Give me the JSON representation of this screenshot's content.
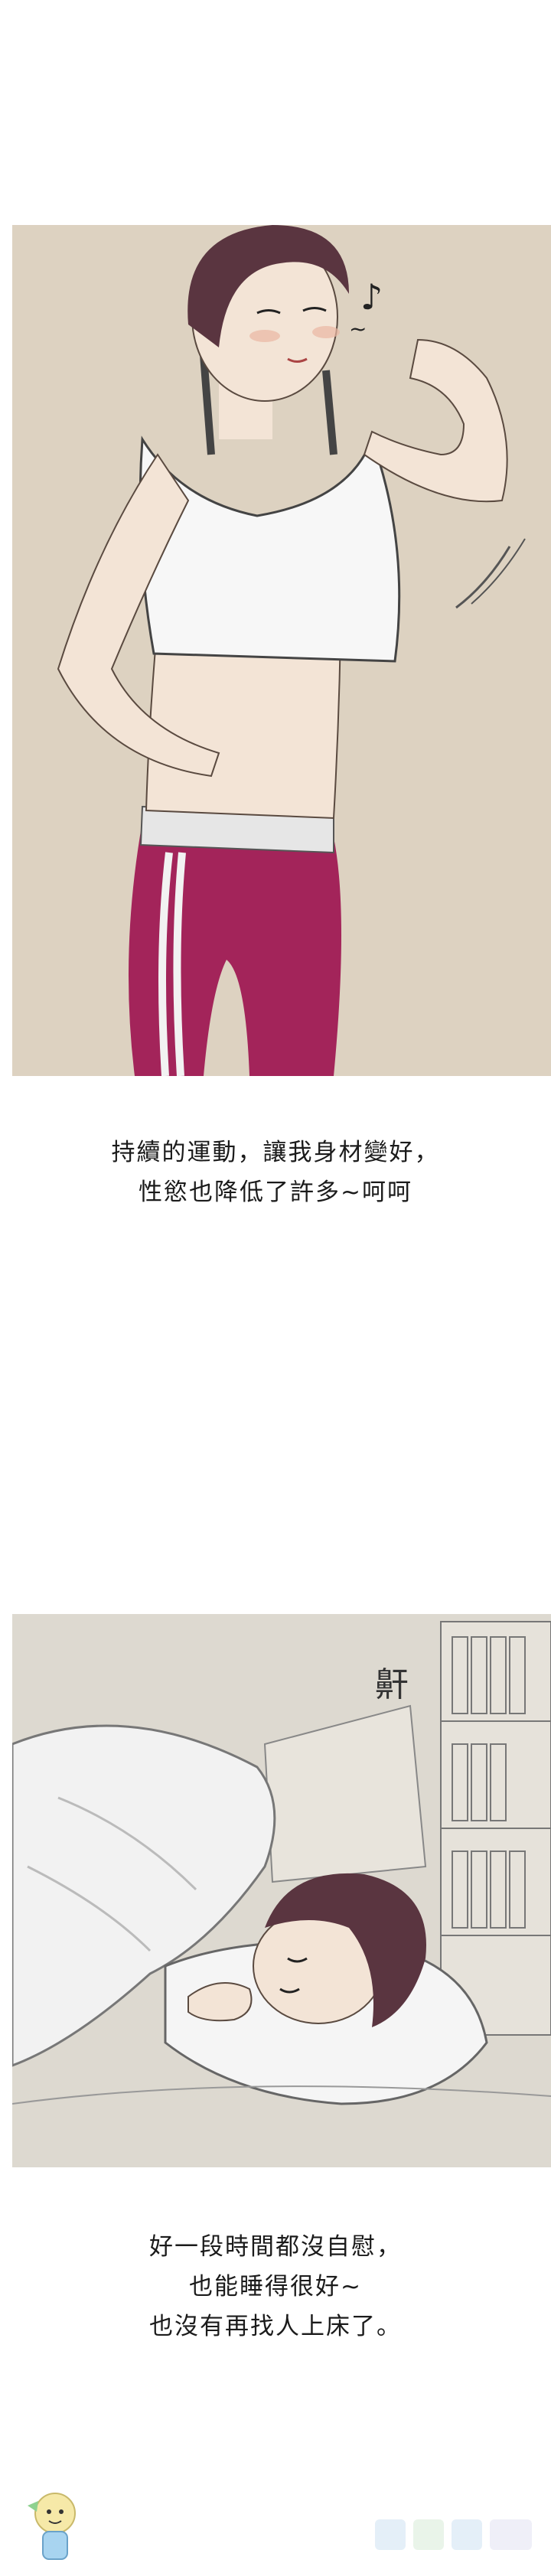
{
  "panels": [
    {
      "id": "panel-1",
      "description_name": "exercise-panel"
    },
    {
      "id": "panel-2",
      "description_name": "sleeping-panel",
      "sfx": "鼾"
    }
  ],
  "captions": {
    "first": {
      "line1": "持續的運動，讓我身材變好，",
      "line2": "性慾也降低了許多~呵呵"
    },
    "second": {
      "line1": "好一段時間都沒自慰，",
      "line2": "也能睡得很好~",
      "line3": "也沒有再找人上床了。"
    }
  },
  "colors": {
    "panel1_bg": "#ddd2c1",
    "panel2_bg": "#ddd9d0",
    "pants": "#a3245a",
    "hair": "#5a3540",
    "skin": "#f3e4d6"
  }
}
